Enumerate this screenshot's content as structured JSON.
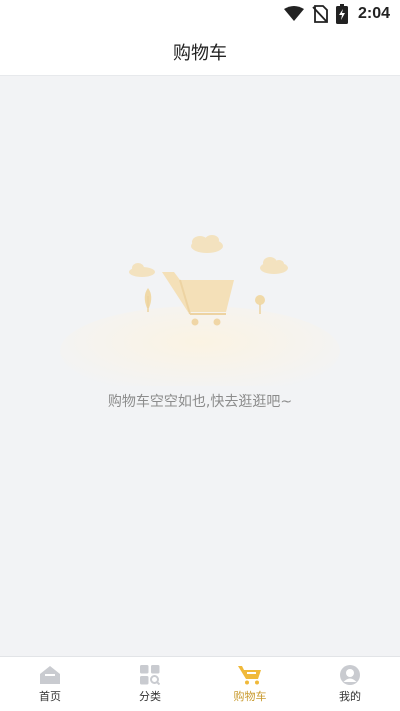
{
  "status_bar": {
    "time": "2:04",
    "icons": [
      "wifi-icon",
      "no-sim-icon",
      "battery-charging-icon"
    ]
  },
  "header": {
    "title": "购物车"
  },
  "empty_state": {
    "illustration": "empty-cart-illustration",
    "message": "购物车空空如也,快去逛逛吧~"
  },
  "tab_bar": {
    "active_color": "#c89a2e",
    "tabs": [
      {
        "label": "首页",
        "icon": "home-icon",
        "active": false
      },
      {
        "label": "分类",
        "icon": "category-icon",
        "active": false
      },
      {
        "label": "购物车",
        "icon": "cart-icon",
        "active": true
      },
      {
        "label": "我的",
        "icon": "profile-icon",
        "active": false
      }
    ]
  }
}
